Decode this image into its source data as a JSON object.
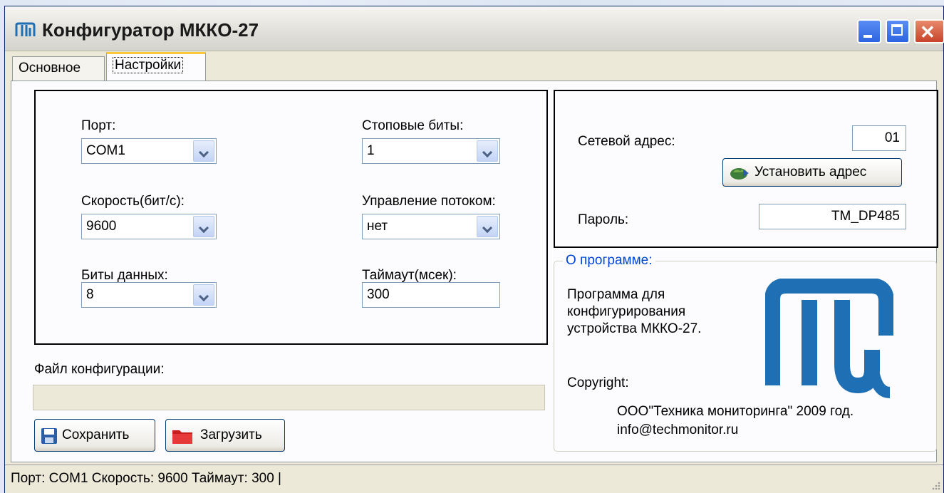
{
  "window": {
    "title": "Конфигуратор МККО-27"
  },
  "tabs": [
    {
      "label": "Основное"
    },
    {
      "label": "Настройки"
    }
  ],
  "port_settings": {
    "port": {
      "label": "Порт:",
      "value": "COM1"
    },
    "speed": {
      "label": "Скорость(бит/с):",
      "value": "9600"
    },
    "data_bits": {
      "label": "Биты данных:",
      "value": "8"
    },
    "stop_bits": {
      "label": "Стоповые биты:",
      "value": "1"
    },
    "flow_control": {
      "label": "Управление потоком:",
      "value": "нет"
    },
    "timeout": {
      "label": "Таймаут(мсек):",
      "value": "300"
    }
  },
  "device": {
    "network_address_label": "Сетевой адрес:",
    "network_address_value": "01",
    "set_address_button": "Установить адрес",
    "password_label": "Пароль:",
    "password_value": "TM_DP485"
  },
  "config_file": {
    "label": "Файл конфигурации:",
    "save_button": "Сохранить",
    "load_button": "Загрузить"
  },
  "about": {
    "title": "О программе:",
    "description_line1": "Программа для",
    "description_line2": "конфигурирования",
    "description_line3": "устройства МККО-27.",
    "copyright_label": "Copyright:",
    "company": "ООО\"Техника мониторинга\" 2009 год.",
    "email": "info@techmonitor.ru"
  },
  "status_bar": {
    "text": "Порт:  COM1  Скорость:  9600  Таймаут:  300  |"
  },
  "colors": {
    "logo": "#1f6fb4",
    "title_blue": "#0046d5"
  }
}
